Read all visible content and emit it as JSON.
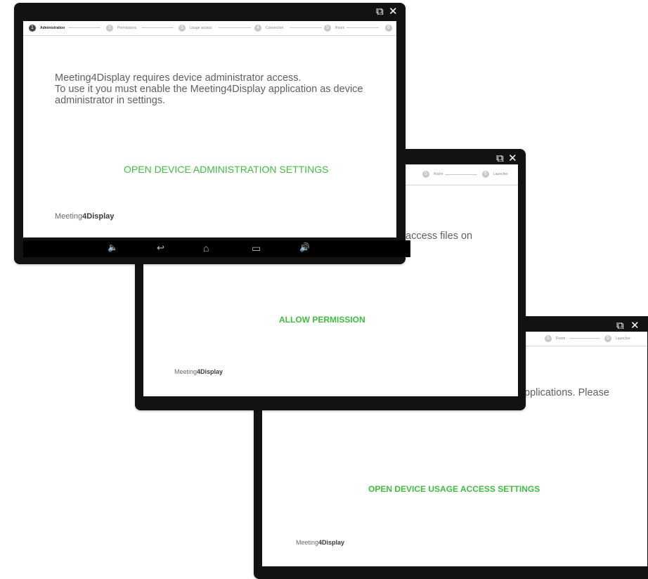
{
  "window_controls": {
    "popout": "⧉",
    "close": "✕"
  },
  "screen1": {
    "steps": [
      {
        "num": "1",
        "label": "Administration"
      },
      {
        "num": "2",
        "label": "Permissions"
      },
      {
        "num": "3",
        "label": "Usage access"
      },
      {
        "num": "4",
        "label": "Connection"
      },
      {
        "num": "5",
        "label": "Room"
      },
      {
        "num": "6",
        "label": "La"
      }
    ],
    "message_lines": [
      "Meeting4Display requires device administrator access.",
      "To use it you must enable the Meeting4Display application as device",
      "administrator in settings."
    ],
    "action": "OPEN DEVICE ADMINISTRATION SETTINGS",
    "nav": {
      "vol_down": "🔈",
      "back": "↩",
      "home": "⌂",
      "recents": "▭",
      "vol_up": "🔊"
    }
  },
  "screen2": {
    "steps": [
      {
        "num": "5",
        "label": "Room"
      },
      {
        "num": "6",
        "label": "Launcher"
      }
    ],
    "message_fragment": "access files on",
    "action": "ALLOW PERMISSION"
  },
  "screen3": {
    "steps": [
      {
        "num": "5",
        "label": "Room"
      },
      {
        "num": "6",
        "label": "Launcher"
      }
    ],
    "message_fragment": "pplications. Please",
    "action": "OPEN DEVICE USAGE ACCESS SETTINGS"
  },
  "logo": {
    "part1": "Meeting",
    "part2": "4Display"
  },
  "colors": {
    "accent": "#3ebd3e",
    "bezel": "#121212",
    "text": "#5f5f5f"
  }
}
